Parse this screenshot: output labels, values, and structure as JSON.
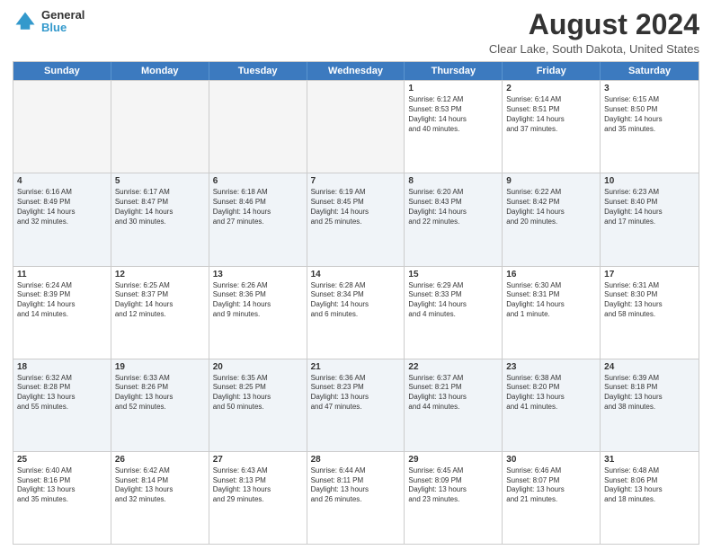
{
  "logo": {
    "general": "General",
    "blue": "Blue"
  },
  "title": "August 2024",
  "location": "Clear Lake, South Dakota, United States",
  "days": [
    "Sunday",
    "Monday",
    "Tuesday",
    "Wednesday",
    "Thursday",
    "Friday",
    "Saturday"
  ],
  "rows": [
    [
      {
        "day": "",
        "empty": true
      },
      {
        "day": "",
        "empty": true
      },
      {
        "day": "",
        "empty": true
      },
      {
        "day": "",
        "empty": true
      },
      {
        "day": "1",
        "lines": [
          "Sunrise: 6:12 AM",
          "Sunset: 8:53 PM",
          "Daylight: 14 hours",
          "and 40 minutes."
        ]
      },
      {
        "day": "2",
        "lines": [
          "Sunrise: 6:14 AM",
          "Sunset: 8:51 PM",
          "Daylight: 14 hours",
          "and 37 minutes."
        ]
      },
      {
        "day": "3",
        "lines": [
          "Sunrise: 6:15 AM",
          "Sunset: 8:50 PM",
          "Daylight: 14 hours",
          "and 35 minutes."
        ]
      }
    ],
    [
      {
        "day": "4",
        "lines": [
          "Sunrise: 6:16 AM",
          "Sunset: 8:49 PM",
          "Daylight: 14 hours",
          "and 32 minutes."
        ]
      },
      {
        "day": "5",
        "lines": [
          "Sunrise: 6:17 AM",
          "Sunset: 8:47 PM",
          "Daylight: 14 hours",
          "and 30 minutes."
        ]
      },
      {
        "day": "6",
        "lines": [
          "Sunrise: 6:18 AM",
          "Sunset: 8:46 PM",
          "Daylight: 14 hours",
          "and 27 minutes."
        ]
      },
      {
        "day": "7",
        "lines": [
          "Sunrise: 6:19 AM",
          "Sunset: 8:45 PM",
          "Daylight: 14 hours",
          "and 25 minutes."
        ]
      },
      {
        "day": "8",
        "lines": [
          "Sunrise: 6:20 AM",
          "Sunset: 8:43 PM",
          "Daylight: 14 hours",
          "and 22 minutes."
        ]
      },
      {
        "day": "9",
        "lines": [
          "Sunrise: 6:22 AM",
          "Sunset: 8:42 PM",
          "Daylight: 14 hours",
          "and 20 minutes."
        ]
      },
      {
        "day": "10",
        "lines": [
          "Sunrise: 6:23 AM",
          "Sunset: 8:40 PM",
          "Daylight: 14 hours",
          "and 17 minutes."
        ]
      }
    ],
    [
      {
        "day": "11",
        "lines": [
          "Sunrise: 6:24 AM",
          "Sunset: 8:39 PM",
          "Daylight: 14 hours",
          "and 14 minutes."
        ]
      },
      {
        "day": "12",
        "lines": [
          "Sunrise: 6:25 AM",
          "Sunset: 8:37 PM",
          "Daylight: 14 hours",
          "and 12 minutes."
        ]
      },
      {
        "day": "13",
        "lines": [
          "Sunrise: 6:26 AM",
          "Sunset: 8:36 PM",
          "Daylight: 14 hours",
          "and 9 minutes."
        ]
      },
      {
        "day": "14",
        "lines": [
          "Sunrise: 6:28 AM",
          "Sunset: 8:34 PM",
          "Daylight: 14 hours",
          "and 6 minutes."
        ]
      },
      {
        "day": "15",
        "lines": [
          "Sunrise: 6:29 AM",
          "Sunset: 8:33 PM",
          "Daylight: 14 hours",
          "and 4 minutes."
        ]
      },
      {
        "day": "16",
        "lines": [
          "Sunrise: 6:30 AM",
          "Sunset: 8:31 PM",
          "Daylight: 14 hours",
          "and 1 minute."
        ]
      },
      {
        "day": "17",
        "lines": [
          "Sunrise: 6:31 AM",
          "Sunset: 8:30 PM",
          "Daylight: 13 hours",
          "and 58 minutes."
        ]
      }
    ],
    [
      {
        "day": "18",
        "lines": [
          "Sunrise: 6:32 AM",
          "Sunset: 8:28 PM",
          "Daylight: 13 hours",
          "and 55 minutes."
        ]
      },
      {
        "day": "19",
        "lines": [
          "Sunrise: 6:33 AM",
          "Sunset: 8:26 PM",
          "Daylight: 13 hours",
          "and 52 minutes."
        ]
      },
      {
        "day": "20",
        "lines": [
          "Sunrise: 6:35 AM",
          "Sunset: 8:25 PM",
          "Daylight: 13 hours",
          "and 50 minutes."
        ]
      },
      {
        "day": "21",
        "lines": [
          "Sunrise: 6:36 AM",
          "Sunset: 8:23 PM",
          "Daylight: 13 hours",
          "and 47 minutes."
        ]
      },
      {
        "day": "22",
        "lines": [
          "Sunrise: 6:37 AM",
          "Sunset: 8:21 PM",
          "Daylight: 13 hours",
          "and 44 minutes."
        ]
      },
      {
        "day": "23",
        "lines": [
          "Sunrise: 6:38 AM",
          "Sunset: 8:20 PM",
          "Daylight: 13 hours",
          "and 41 minutes."
        ]
      },
      {
        "day": "24",
        "lines": [
          "Sunrise: 6:39 AM",
          "Sunset: 8:18 PM",
          "Daylight: 13 hours",
          "and 38 minutes."
        ]
      }
    ],
    [
      {
        "day": "25",
        "lines": [
          "Sunrise: 6:40 AM",
          "Sunset: 8:16 PM",
          "Daylight: 13 hours",
          "and 35 minutes."
        ]
      },
      {
        "day": "26",
        "lines": [
          "Sunrise: 6:42 AM",
          "Sunset: 8:14 PM",
          "Daylight: 13 hours",
          "and 32 minutes."
        ]
      },
      {
        "day": "27",
        "lines": [
          "Sunrise: 6:43 AM",
          "Sunset: 8:13 PM",
          "Daylight: 13 hours",
          "and 29 minutes."
        ]
      },
      {
        "day": "28",
        "lines": [
          "Sunrise: 6:44 AM",
          "Sunset: 8:11 PM",
          "Daylight: 13 hours",
          "and 26 minutes."
        ]
      },
      {
        "day": "29",
        "lines": [
          "Sunrise: 6:45 AM",
          "Sunset: 8:09 PM",
          "Daylight: 13 hours",
          "and 23 minutes."
        ]
      },
      {
        "day": "30",
        "lines": [
          "Sunrise: 6:46 AM",
          "Sunset: 8:07 PM",
          "Daylight: 13 hours",
          "and 21 minutes."
        ]
      },
      {
        "day": "31",
        "lines": [
          "Sunrise: 6:48 AM",
          "Sunset: 8:06 PM",
          "Daylight: 13 hours",
          "and 18 minutes."
        ]
      }
    ]
  ]
}
